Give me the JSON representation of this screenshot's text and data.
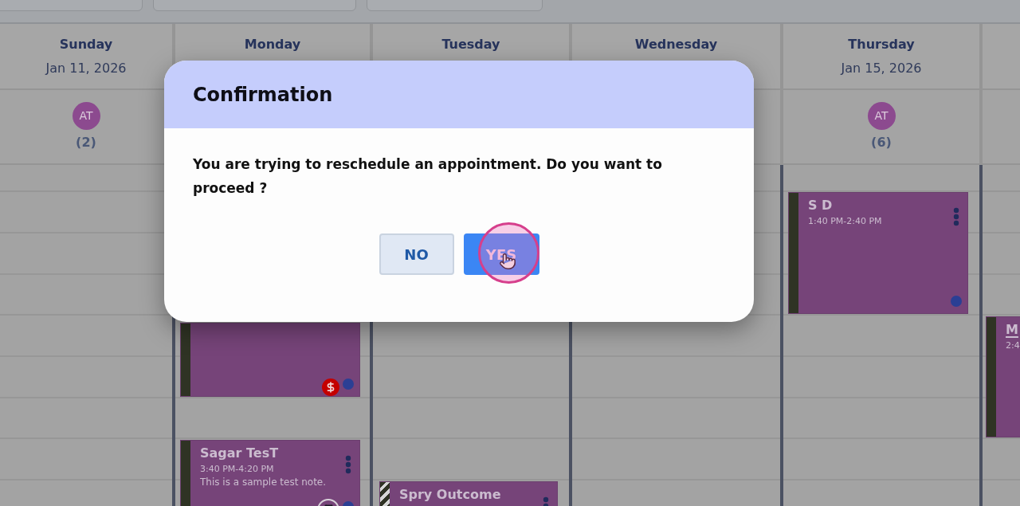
{
  "calendar": {
    "days": [
      {
        "name": "Sunday",
        "date": "Jan 11, 2026",
        "staff": {
          "initials": "AT",
          "count": "(2)"
        }
      },
      {
        "name": "Monday",
        "events": [
          {
            "kind": "solid",
            "indicators": [
              {
                "kind": "payment"
              },
              {
                "kind": "status"
              }
            ]
          },
          {
            "title": "Sagar TesT",
            "time": "3:40 PM-4:20 PM",
            "note": "This is a sample test note.",
            "kind": "solid",
            "menu": true,
            "underlined": false,
            "indicators": [
              {
                "kind": "waiting"
              },
              {
                "kind": "status"
              }
            ]
          }
        ]
      },
      {
        "name": "Tuesday",
        "events": [
          {
            "title": "Spry Outcome",
            "kind": "striped",
            "menu": true,
            "underlined": false
          }
        ]
      },
      {
        "name": "Wednesday"
      },
      {
        "name": "Thursday",
        "date": "Jan 15, 2026",
        "staff": {
          "initials": "AT",
          "count": "(6)"
        },
        "events": [
          {
            "title": "S D",
            "time": "1:40 PM-2:40 PM",
            "kind": "solid",
            "menu": true,
            "underlined": false,
            "indicators": [
              {
                "kind": "status"
              }
            ]
          }
        ]
      },
      {
        "events": [
          {
            "title": "M",
            "time": "2:4",
            "kind": "solid",
            "underlined": true
          }
        ]
      }
    ]
  },
  "dialog": {
    "title": "Confirmation",
    "message": "You are trying to reschedule an appointment. Do you want to proceed ?",
    "buttons": [
      {
        "label": "NO",
        "kind": "secondary",
        "clicked": false
      },
      {
        "label": "YES",
        "kind": "primary",
        "clicked": true
      }
    ]
  }
}
